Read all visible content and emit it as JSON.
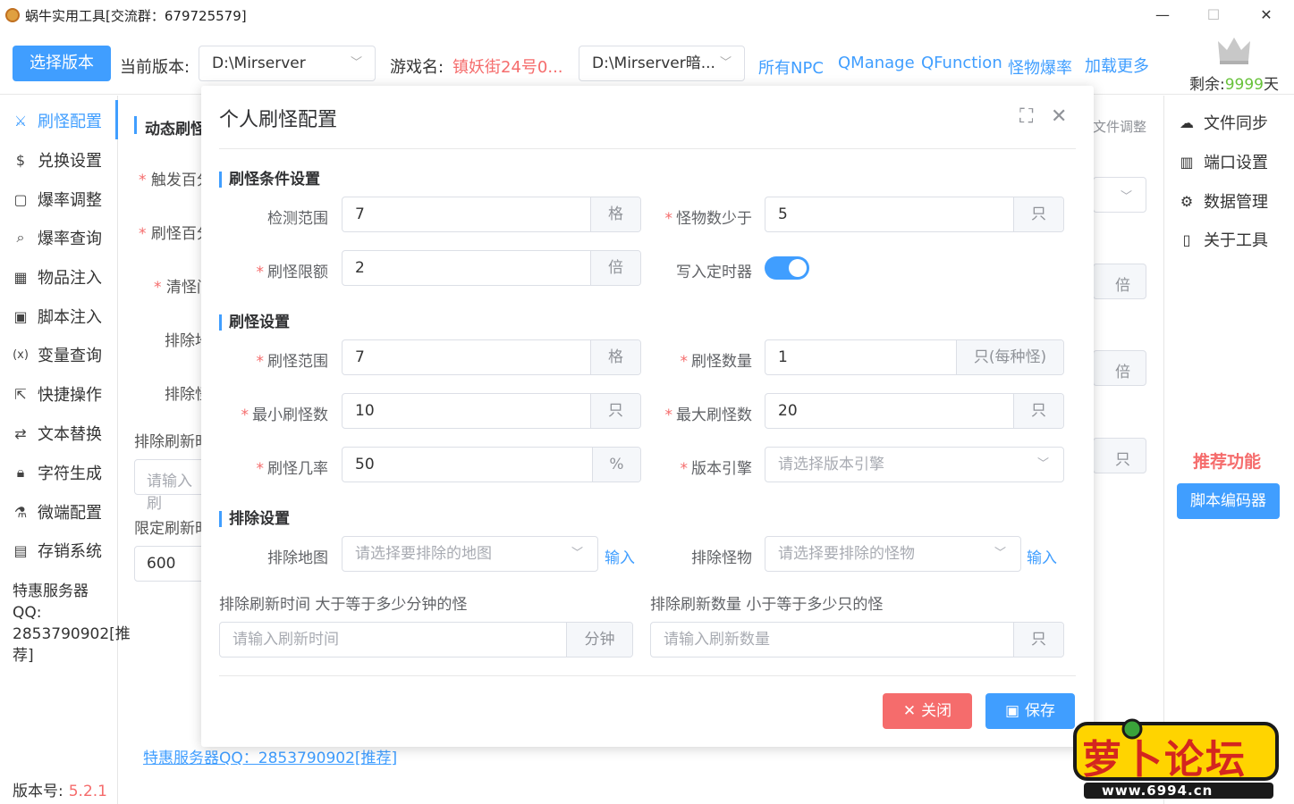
{
  "window": {
    "title": "蜗牛实用工具[交流群：679725579]",
    "minimize": "—",
    "maximize": "☐",
    "close": "✕"
  },
  "topbar": {
    "select_version_button": "选择版本",
    "current_version_label": "当前版本:",
    "current_version_value": "D:\\Mirserver",
    "game_name_label": "游戏名:",
    "game_name_value": "镇妖街24号0...",
    "path_select_value": "D:\\Mirserver暗...",
    "links": [
      "所有NPC",
      "QManage",
      "QFunction",
      "怪物爆率",
      "加载更多"
    ],
    "remaining_label": "剩余:",
    "remaining_value": "9999",
    "remaining_unit": "天"
  },
  "sidebar": {
    "items": [
      {
        "label": "刷怪配置",
        "icon": "spawn-icon"
      },
      {
        "label": "兑换设置",
        "icon": "dollar-icon"
      },
      {
        "label": "爆率调整",
        "icon": "box-icon"
      },
      {
        "label": "爆率查询",
        "icon": "search-icon"
      },
      {
        "label": "物品注入",
        "icon": "grid-icon"
      },
      {
        "label": "脚本注入",
        "icon": "terminal-icon"
      },
      {
        "label": "变量查询",
        "icon": "variable-icon"
      },
      {
        "label": "快捷操作",
        "icon": "external-link-icon"
      },
      {
        "label": "文本替换",
        "icon": "replace-icon"
      },
      {
        "label": "字符生成",
        "icon": "lock-icon"
      },
      {
        "label": "微端配置",
        "icon": "tool-icon"
      },
      {
        "label": "存销系统",
        "icon": "store-icon"
      }
    ],
    "promo_lines": [
      "特惠服务器",
      "QQ:",
      "2853790902[推",
      "荐]"
    ],
    "version_label": "版本号:",
    "version_value": "5.2.1"
  },
  "background": {
    "section_title": "动态刷怪",
    "file_adjust": "文件调整",
    "trigger_label": "触发百分",
    "spawn_pct_label": "刷怪百分",
    "clear_label": "清怪间",
    "exclude1": "排除地",
    "exclude2": "排除怪",
    "exclude_refresh": "排除刷新时",
    "input_placeholder": "请输入刷",
    "limit_refresh": "限定刷新时",
    "limit_value": "600",
    "unit_bei1": "倍",
    "unit_bei2": "倍",
    "unit_zhi": "只",
    "footer_link": "特惠服务器QQ：2853790902[推荐]"
  },
  "right_sidebar": {
    "items": [
      {
        "label": "文件同步",
        "icon": "cloud-upload-icon"
      },
      {
        "label": "端口设置",
        "icon": "port-icon"
      },
      {
        "label": "数据管理",
        "icon": "gear-icon"
      },
      {
        "label": "关于工具",
        "icon": "clipboard-icon"
      }
    ],
    "recommend_title": "推荐功能",
    "script_encoder_button": "脚本编码器"
  },
  "dialog": {
    "title": "个人刷怪配置",
    "fullscreen_icon": "⛶",
    "close_icon": "✕",
    "sections": {
      "condition": "刷怪条件设置",
      "spawn": "刷怪设置",
      "exclude": "排除设置"
    },
    "fields": {
      "detect_range": {
        "label": "检测范围",
        "value": "7",
        "unit": "格",
        "required": false
      },
      "monster_less": {
        "label": "怪物数少于",
        "value": "5",
        "unit": "只",
        "required": true
      },
      "spawn_limit": {
        "label": "刷怪限额",
        "value": "2",
        "unit": "倍",
        "required": true
      },
      "write_timer": {
        "label": "写入定时器",
        "on": true
      },
      "spawn_range": {
        "label": "刷怪范围",
        "value": "7",
        "unit": "格",
        "required": true
      },
      "spawn_count": {
        "label": "刷怪数量",
        "value": "1",
        "unit": "只(每种怪)",
        "required": true
      },
      "min_count": {
        "label": "最小刷怪数",
        "value": "10",
        "unit": "只",
        "required": true
      },
      "max_count": {
        "label": "最大刷怪数",
        "value": "20",
        "unit": "只",
        "required": true
      },
      "spawn_rate": {
        "label": "刷怪几率",
        "value": "50",
        "unit": "%",
        "required": true
      },
      "engine": {
        "label": "版本引擎",
        "placeholder": "请选择版本引擎",
        "required": true
      },
      "exclude_map": {
        "label": "排除地图",
        "placeholder": "请选择要排除的地图",
        "link": "输入"
      },
      "exclude_monster": {
        "label": "排除怪物",
        "placeholder": "请选择要排除的怪物",
        "link": "输入"
      },
      "exclude_time": {
        "label": "排除刷新时间 大于等于多少分钟的怪",
        "placeholder": "请输入刷新时间",
        "unit": "分钟"
      },
      "exclude_qty": {
        "label": "排除刷新数量 小于等于多少只的怪",
        "placeholder": "请输入刷新数量",
        "unit": "只"
      }
    },
    "close_button": "关闭",
    "save_button": "保存"
  },
  "logo": {
    "text": "萝卜论坛",
    "url_text": "www.6994.cn"
  },
  "colors": {
    "primary": "#409eff",
    "danger": "#f56c6c",
    "required": "#f56c6c",
    "remaining": "#67c23a",
    "game_name": "#f56c6c"
  }
}
